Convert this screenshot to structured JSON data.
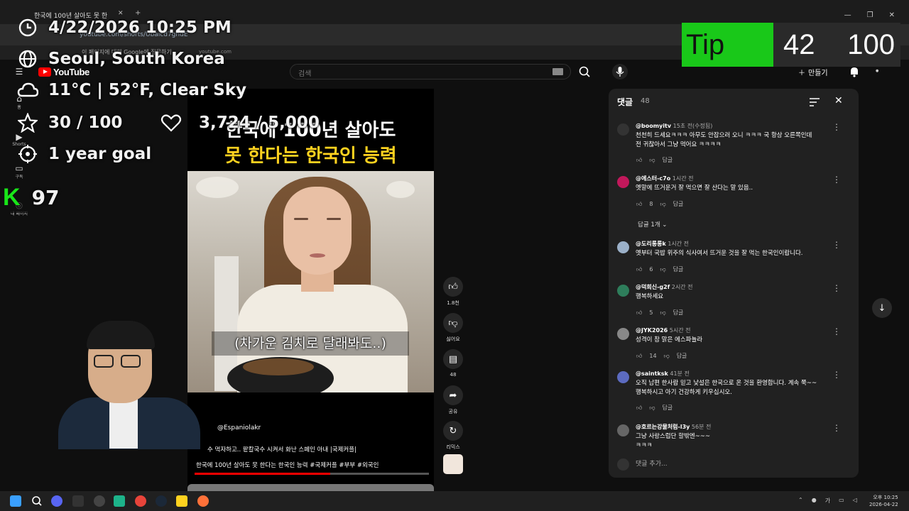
{
  "browser": {
    "tab_title": "한국에 100년 살아도 못 한",
    "url": "youtube.com/shorts/Ubaicd7gndE",
    "bookmark_text": "이 페이지에 대해 Google에 질문하기",
    "bookmark_domain": "youtube.com"
  },
  "overlay": {
    "datetime": "4/22/2026 10:25 PM",
    "location": "Seoul, South Korea",
    "weather": "11°C | 52°F, Clear Sky",
    "progress": "30 / 100",
    "hearts": "3,724 / 5,000",
    "goal": "1 year goal",
    "k_count": "97",
    "tip_label": "Tip",
    "tip_current": "42",
    "tip_target": "100"
  },
  "youtube": {
    "logo_text": "YouTube",
    "search_placeholder": "검색",
    "create_label": "만들기",
    "sidebar": [
      {
        "label": "홈"
      },
      {
        "label": "Shorts"
      },
      {
        "label": "구독"
      },
      {
        "label": "내 페이지"
      }
    ]
  },
  "video": {
    "title_line1": "한국에 100년 살아도",
    "title_line2": "못 한다는 한국인 능력",
    "subtitle": "(차가운 김치로 달래봐도..)",
    "channel": "@Espaniolakr",
    "description": "수 먹자하고.. 팥칼국수 시켜서 화난 스페인 아내 |국제커플|",
    "caption": "한국에 100년 살아도 못 한다는 한국인 능력 #국제커플 #부부 #외국인",
    "progress_fraction": 0.58
  },
  "actions": {
    "like_count": "1.8천",
    "dislike_label": "싫어요",
    "comment_count": "48",
    "share_label": "공유",
    "remix_label": "리믹스"
  },
  "comments_panel": {
    "title": "댓글",
    "count": "48",
    "reply_toggle": "답글 1개",
    "add_placeholder": "댓글 추가...",
    "items": [
      {
        "author": "@boomyitv",
        "time": "15초 전(수정됨)",
        "text1": "천천히 드세요ㅋㅋㅋ 아무도 안잡으러 오니 ㅋㅋㅋ 국 항상 오른쪽인데",
        "text2": "전 귀찮아서 그냥 먹어요 ㅋㅋㅋㅋ",
        "likes": "",
        "reply": "답글"
      },
      {
        "author": "@에스터-c7o",
        "time": "1시간 전",
        "text1": "옛말에 뜨거운거 잘 먹으면 잘 산다는 말 있음..",
        "text2": "",
        "likes": "8",
        "reply": "답글"
      },
      {
        "author": "@도리롱롱k",
        "time": "1시간 전",
        "text1": "옛부터 국밥 위주의 식사여서 뜨거운 것을 잘 먹는 한국인이랍니다.",
        "text2": "",
        "likes": "6",
        "reply": "답글"
      },
      {
        "author": "@덕희신-g2f",
        "time": "2시간 전",
        "text1": "행복하세요",
        "text2": "",
        "likes": "5",
        "reply": "답글"
      },
      {
        "author": "@JYK2026",
        "time": "5시간 전",
        "text1": "성격이 참 맑은 에스파뇰라",
        "text2": "",
        "likes": "14",
        "reply": "답글"
      },
      {
        "author": "@saintksk",
        "time": "41분 전",
        "text1": "오직 남편 한사람 믿고 낯설은 한국으로 온 것을 환영합니다. 계속 쭉~~",
        "text2": "행복하시고 아기 건강하게 키우십시오.",
        "likes": "",
        "reply": "답글"
      },
      {
        "author": "@호르는강물처럼-l3y",
        "time": "56분 전",
        "text1": "그냥 사랑스럽단 할밖엔~~~",
        "text2": "ㅋㅋㅋ",
        "likes": "",
        "reply": ""
      }
    ]
  },
  "taskbar": {
    "ime": "가",
    "time": "오후 10:25",
    "date": "2026-04-22"
  },
  "colors": {
    "tip_green": "#19c819",
    "yt_red": "#ff0000",
    "title_yellow": "#ffd21f"
  }
}
